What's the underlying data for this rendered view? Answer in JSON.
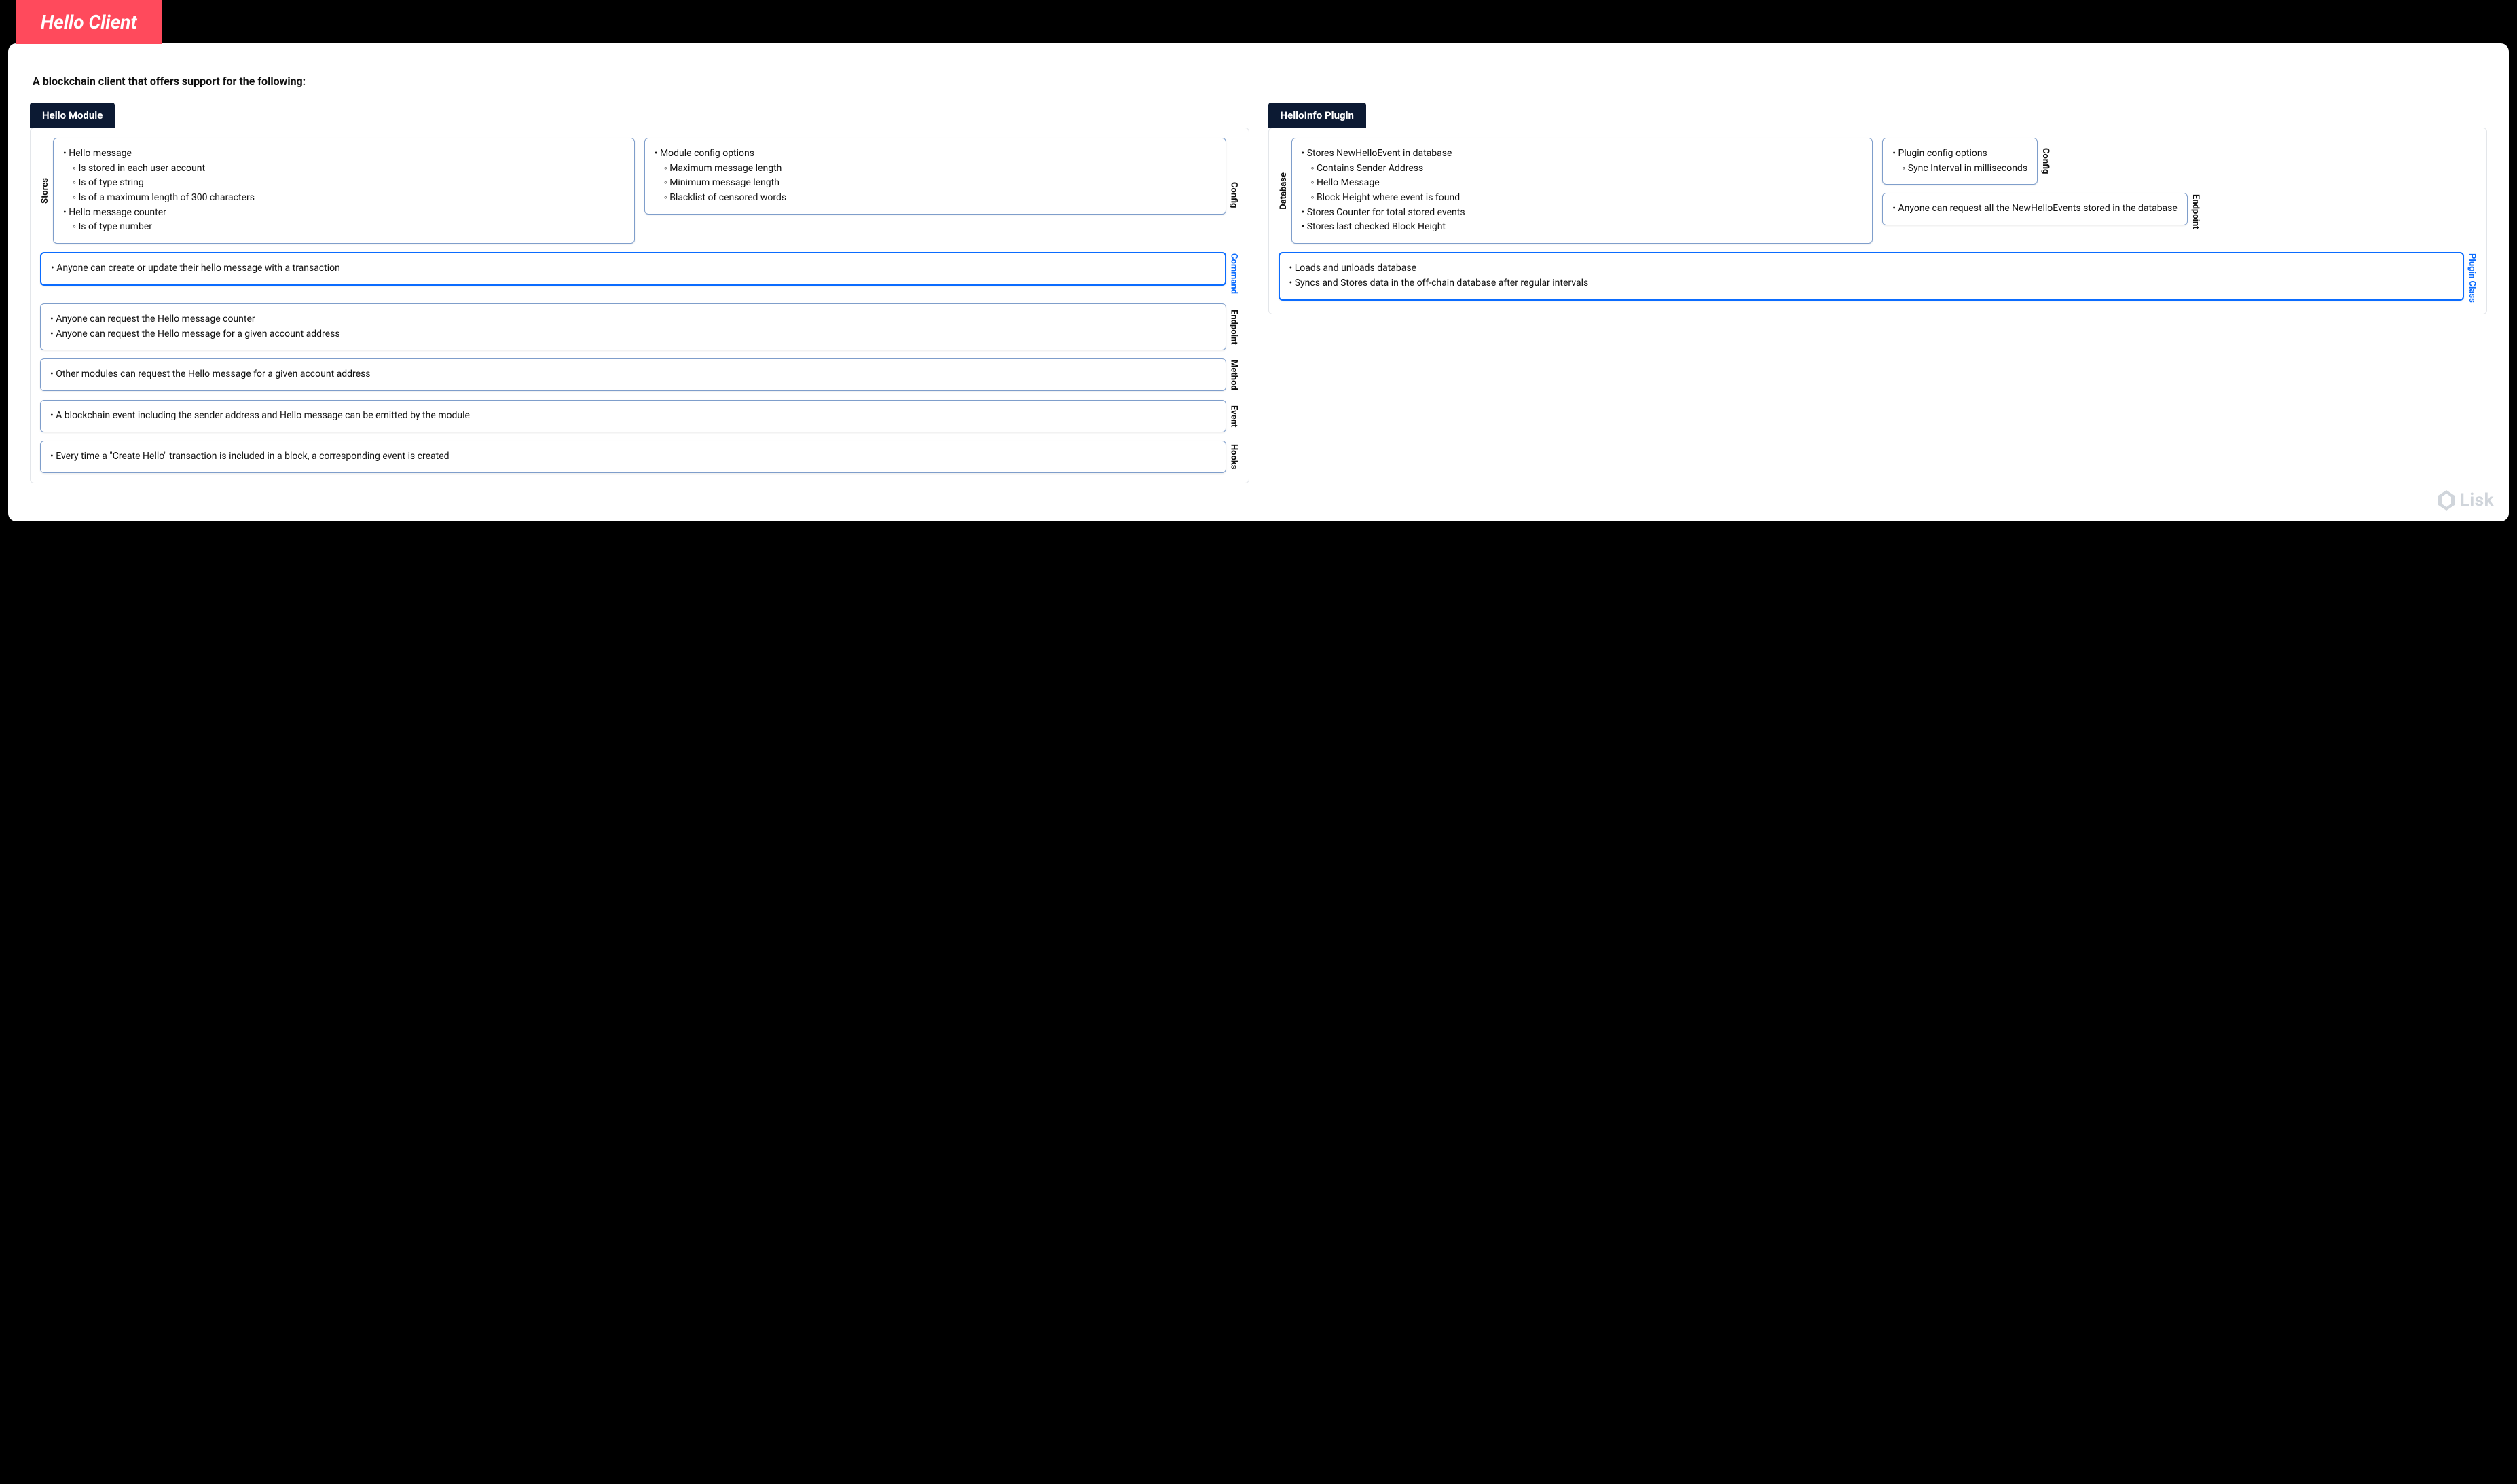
{
  "title": "Hello Client",
  "subtitle": "A blockchain client that offers support for the following:",
  "brand": "Lisk",
  "module": {
    "tab": "Hello Module",
    "stores": {
      "label": "Stores",
      "i0": "Hello message",
      "i0_0": "Is stored in each user account",
      "i0_1": "Is of type string",
      "i0_2": "Is of a maximum length of 300 characters",
      "i1": "Hello message counter",
      "i1_0": "Is of type number"
    },
    "config": {
      "label": "Config",
      "i0": "Module config options",
      "i0_0": "Maximum message length",
      "i0_1": "Minimum message length",
      "i0_2": "Blacklist of censored words"
    },
    "command": {
      "label": "Command",
      "i0": "Anyone can create or update their hello message with a transaction"
    },
    "endpoint": {
      "label": "Endpoint",
      "i0": "Anyone can request the Hello message counter",
      "i1": "Anyone can request the Hello message for a given account address"
    },
    "method": {
      "label": "Method",
      "i0": "Other modules can request the Hello message for a given account address"
    },
    "event": {
      "label": "Event",
      "i0": "A blockchain event including the sender address and Hello message can be emitted by the module"
    },
    "hooks": {
      "label": "Hooks",
      "i0": "Every time a \"Create Hello\" transaction is included in a block, a corresponding event is created"
    }
  },
  "plugin": {
    "tab": "HelloInfo Plugin",
    "database": {
      "label": "Database",
      "i0": "Stores NewHelloEvent in database",
      "i0_0": "Contains Sender Address",
      "i0_1": "Hello Message",
      "i0_2": "Block Height where event is found",
      "i1": "Stores Counter for total stored events",
      "i2": "Stores last checked Block Height"
    },
    "config": {
      "label": "Config",
      "i0": "Plugin config options",
      "i0_0": "Sync Interval in milliseconds"
    },
    "endpoint": {
      "label": "Endpoint",
      "i0": "Anyone can request all the NewHelloEvents stored in the database"
    },
    "pluginClass": {
      "label": "Plugin Class",
      "i0": "Loads and unloads database",
      "i1": "Syncs and Stores data in the off-chain database after regular intervals"
    }
  }
}
